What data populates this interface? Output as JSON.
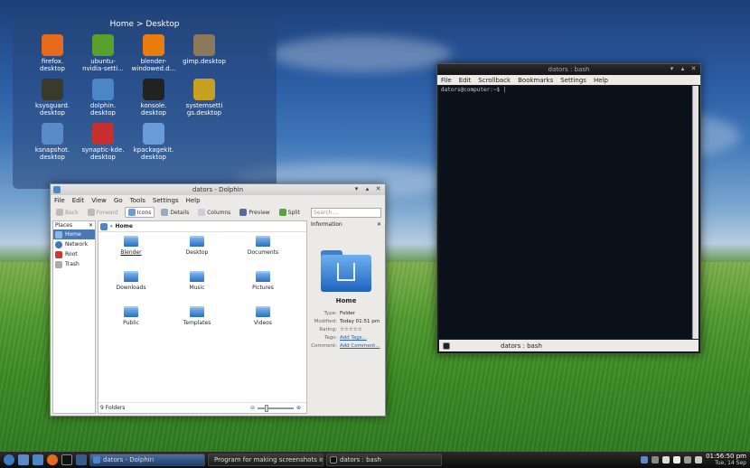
{
  "desktop": {
    "folderview_title": "Home > Desktop",
    "icons": [
      {
        "label": "firefox.\ndesktop",
        "icon": "firefox-icon",
        "color": "#e66a1c"
      },
      {
        "label": "ubuntu-\nnvidia-setti...",
        "icon": "nvidia-icon",
        "color": "#5aa02c"
      },
      {
        "label": "blender-\nwindowed.d...",
        "icon": "blender-icon",
        "color": "#e87d0d"
      },
      {
        "label": "gimp.desktop",
        "icon": "gimp-icon",
        "color": "#8a7a5a"
      },
      {
        "label": "ksysguard.\ndesktop",
        "icon": "ksysguard-icon",
        "color": "#3a3a2a"
      },
      {
        "label": "dolphin.\ndesktop",
        "icon": "dolphin-icon",
        "color": "#4a86c8"
      },
      {
        "label": "konsole.\ndesktop",
        "icon": "konsole-icon",
        "color": "#222222"
      },
      {
        "label": "systemsetti\ngs.desktop",
        "icon": "system-settings-icon",
        "color": "#c8a020"
      },
      {
        "label": "ksnapshot.\ndesktop",
        "icon": "ksnapshot-icon",
        "color": "#5a8ac8"
      },
      {
        "label": "synaptic-kde.\ndesktop",
        "icon": "synaptic-icon",
        "color": "#c83030"
      },
      {
        "label": "kpackagekit.\ndesktop",
        "icon": "kpackagekit-icon",
        "color": "#6a9ad8"
      }
    ]
  },
  "dolphin": {
    "title": "dators - Dolphin",
    "menu": [
      "File",
      "Edit",
      "View",
      "Go",
      "Tools",
      "Settings",
      "Help"
    ],
    "toolbar": {
      "back": "Back",
      "forward": "Forward",
      "icons": "Icons",
      "details": "Details",
      "columns": "Columns",
      "preview": "Preview",
      "split": "Split",
      "search_placeholder": "Search..."
    },
    "places": {
      "header": "Places",
      "items": [
        "Home",
        "Network",
        "Root",
        "Trash"
      ]
    },
    "breadcrumb": "Home",
    "files": [
      "Blender",
      "Desktop",
      "Documents",
      "Downloads",
      "Music",
      "Pictures",
      "Public",
      "Templates",
      "Videos"
    ],
    "status": "9 Folders",
    "information": {
      "header": "Information",
      "name": "Home",
      "rows": [
        {
          "k": "Type:",
          "v": "Folder"
        },
        {
          "k": "Modified:",
          "v": "Today 01:51 pm"
        },
        {
          "k": "Rating:",
          "v": "☆☆☆☆☆"
        },
        {
          "k": "Tags:",
          "v": "Add Tags..."
        },
        {
          "k": "Comment:",
          "v": "Add Comment..."
        }
      ]
    }
  },
  "terminal": {
    "title": "dators : bash",
    "menu": [
      "File",
      "Edit",
      "Scrollback",
      "Bookmarks",
      "Settings",
      "Help"
    ],
    "prompt": "dators@computer:~$ |",
    "tab": "dators : bash"
  },
  "panel": {
    "tasks": [
      "dators - Dolphin",
      "Program for making screenshots in K",
      "dators : bash"
    ],
    "time": "01:56:50 pm",
    "date": "Tue, 14 Sep"
  }
}
